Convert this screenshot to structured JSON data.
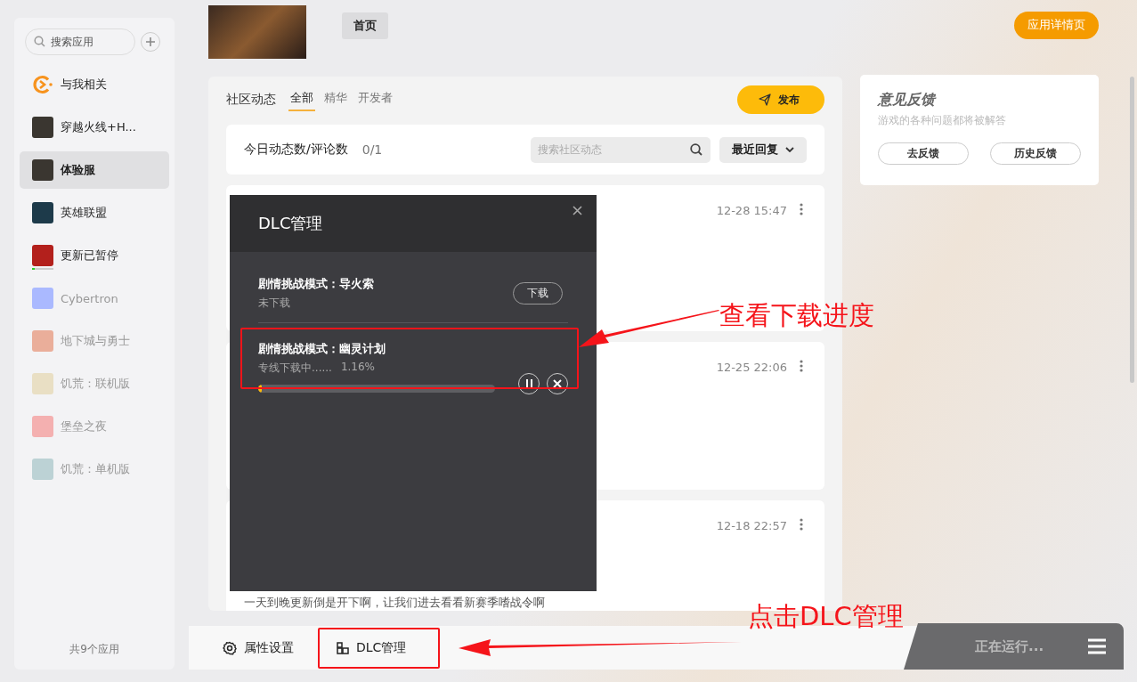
{
  "sidebar": {
    "search": {
      "placeholder": "搜索应用"
    },
    "items": [
      {
        "label": "与我相关",
        "kind": "mention",
        "selected": false,
        "dimmed": false,
        "color": "#f7931e"
      },
      {
        "label": "穿越火线+H...",
        "kind": "app",
        "selected": false,
        "dimmed": false,
        "color": "#3a3630"
      },
      {
        "label": "体验服",
        "kind": "app",
        "selected": true,
        "dimmed": false,
        "color": "#3a3630"
      },
      {
        "label": "英雄联盟",
        "kind": "app",
        "selected": false,
        "dimmed": false,
        "color": "#1d3a4a"
      },
      {
        "label": "更新已暂停",
        "kind": "app",
        "selected": false,
        "dimmed": false,
        "color": "#b3201c",
        "level": 0.12
      },
      {
        "label": "Cybertron",
        "kind": "app",
        "selected": false,
        "dimmed": true,
        "color": "#aab9ff"
      },
      {
        "label": "地下城与勇士",
        "kind": "app",
        "selected": false,
        "dimmed": true,
        "color": "#eaae9a"
      },
      {
        "label": "饥荒：联机版",
        "kind": "app",
        "selected": false,
        "dimmed": true,
        "color": "#e9dfc4"
      },
      {
        "label": "堡垒之夜",
        "kind": "app",
        "selected": false,
        "dimmed": true,
        "color": "#f4b0b0"
      },
      {
        "label": "饥荒：单机版",
        "kind": "app",
        "selected": false,
        "dimmed": true,
        "color": "#bcd2d5"
      }
    ],
    "footer": "共9个应用"
  },
  "header": {
    "tabs": [
      {
        "label": "首页",
        "selected": true
      }
    ],
    "details_button": "应用详情页"
  },
  "community": {
    "title": "社区动态",
    "tabs": [
      {
        "label": "全部",
        "selected": true
      },
      {
        "label": "精华",
        "selected": false
      },
      {
        "label": "开发者",
        "selected": false
      }
    ],
    "post_button": "发布",
    "stats_label": "今日动态数/评论数",
    "stats_value": "0/1",
    "search": {
      "placeholder": "搜索社区动态"
    },
    "sort": "最近回复",
    "posts": [
      {
        "time": "12-28 15:47"
      },
      {
        "time": "12-25 22:06"
      },
      {
        "time": "12-18 22:57",
        "text": "一天到晚更新倒是开下啊，让我们进去看看新赛季嗜战令啊"
      }
    ]
  },
  "feedback": {
    "title": "意见反馈",
    "subtitle": "游戏的各种问题都将被解答",
    "buttons": [
      "去反馈",
      "历史反馈"
    ]
  },
  "bottom_bar": {
    "tabs": [
      {
        "label": "属性设置",
        "kind": "settings"
      },
      {
        "label": "DLC管理",
        "kind": "dlc"
      }
    ],
    "running": "正在运行..."
  },
  "dlc_dialog": {
    "title": "DLC管理",
    "items": [
      {
        "kind": "available",
        "title": "剧情挑战模式：导火索",
        "status": "未下载",
        "button": "下载"
      },
      {
        "kind": "downloading",
        "title": "剧情挑战模式：幽灵计划",
        "status": "专线下载中......",
        "percent": "1.16%",
        "level": 0.0116
      }
    ]
  },
  "annotations": [
    {
      "text": "查看下载进度"
    },
    {
      "text": "点击DLC管理"
    }
  ]
}
